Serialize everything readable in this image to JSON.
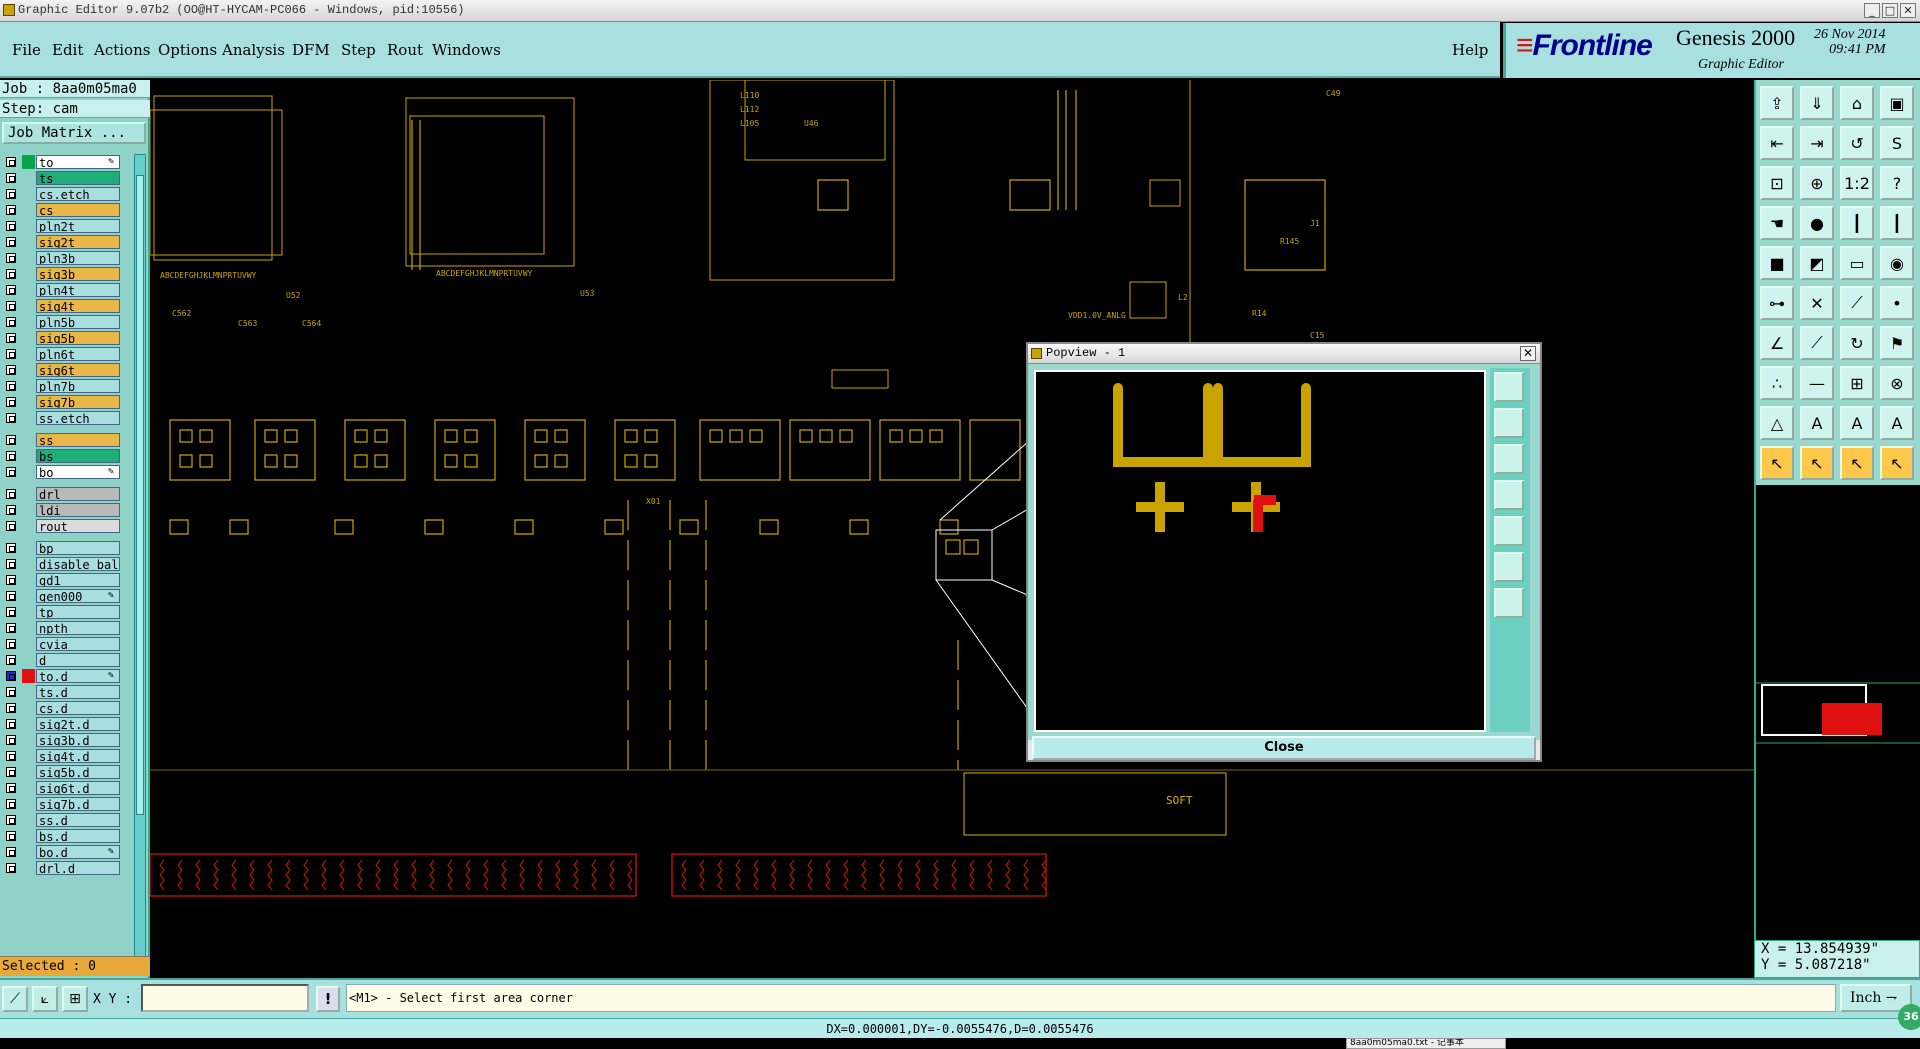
{
  "window": {
    "title": "Graphic Editor 9.07b2 (OO@HT-HYCAM-PC066 - Windows, pid:10556)"
  },
  "menu": [
    {
      "label": "File"
    },
    {
      "label": "Edit"
    },
    {
      "label": "Actions"
    },
    {
      "label": "Options"
    },
    {
      "label": "Analysis"
    },
    {
      "label": "DFM"
    },
    {
      "label": "Step"
    },
    {
      "label": "Rout"
    },
    {
      "label": "Windows"
    }
  ],
  "help_label": "Help",
  "logo": {
    "brand": "Frontline",
    "product": "Genesis 2000",
    "subtitle": "Graphic Editor",
    "date": "26 Nov 2014",
    "time": "09:41 PM"
  },
  "job": {
    "job_line": "Job : 8aa0m05ma0",
    "step_line": "Step: cam",
    "matrix_button": "Job Matrix ..."
  },
  "colors": {
    "gold": "#c9a400",
    "red": "#e01010",
    "cyan": "#a8e0e0",
    "layer_orange": "#e9b648",
    "layer_green": "#1fad7a",
    "layer_cyan": "#a8dede",
    "layer_gray": "#b9b9b9"
  },
  "layers": [
    {
      "name": "to",
      "color": "#ffffff",
      "swatch": "#0aa34a",
      "pen": true
    },
    {
      "name": "ts",
      "color": "#1fad7a",
      "swatch": ""
    },
    {
      "name": "cs.etch",
      "color": "#a8dede",
      "swatch": ""
    },
    {
      "name": "cs",
      "color": "#e9b648",
      "swatch": ""
    },
    {
      "name": "pln2t",
      "color": "#a8dede",
      "swatch": ""
    },
    {
      "name": "sig2t",
      "color": "#e9b648",
      "swatch": ""
    },
    {
      "name": "pln3b",
      "color": "#a8dede",
      "swatch": ""
    },
    {
      "name": "sig3b",
      "color": "#e9b648",
      "swatch": ""
    },
    {
      "name": "pln4t",
      "color": "#a8dede",
      "swatch": ""
    },
    {
      "name": "sig4t",
      "color": "#e9b648",
      "swatch": ""
    },
    {
      "name": "pln5b",
      "color": "#a8dede",
      "swatch": ""
    },
    {
      "name": "sig5b",
      "color": "#e9b648",
      "swatch": ""
    },
    {
      "name": "pln6t",
      "color": "#a8dede",
      "swatch": ""
    },
    {
      "name": "sig6t",
      "color": "#e9b648",
      "swatch": ""
    },
    {
      "name": "pln7b",
      "color": "#a8dede",
      "swatch": ""
    },
    {
      "name": "sig7b",
      "color": "#e9b648",
      "swatch": ""
    },
    {
      "name": "ss.etch",
      "color": "#a8dede",
      "swatch": ""
    },
    {
      "gap": true
    },
    {
      "name": "ss",
      "color": "#e9b648",
      "swatch": ""
    },
    {
      "name": "bs",
      "color": "#1fad7a",
      "swatch": ""
    },
    {
      "name": "bo",
      "color": "#ffffff",
      "swatch": "",
      "pen": true
    },
    {
      "gap": true
    },
    {
      "name": "drl",
      "color": "#b9b9b9",
      "swatch": ""
    },
    {
      "name": "ldi",
      "color": "#b9b9b9",
      "swatch": ""
    },
    {
      "name": "rout",
      "color": "#dcdcdc",
      "swatch": ""
    },
    {
      "gap": true
    },
    {
      "name": "bp",
      "color": "#a8dede",
      "swatch": ""
    },
    {
      "name": "disable_bal",
      "color": "#a8dede",
      "swatch": ""
    },
    {
      "name": "gd1",
      "color": "#a8dede",
      "swatch": ""
    },
    {
      "name": "gen000",
      "color": "#a8dede",
      "swatch": "",
      "pen": true
    },
    {
      "name": "tp",
      "color": "#a8dede",
      "swatch": ""
    },
    {
      "name": "npth",
      "color": "#a8dede",
      "swatch": ""
    },
    {
      "name": "cvia",
      "color": "#a8dede",
      "swatch": ""
    },
    {
      "name": "d",
      "color": "#a8dede",
      "swatch": ""
    },
    {
      "name": "to.d",
      "color": "#a8dede",
      "swatch": "#e01010",
      "checked": true,
      "pen": true
    },
    {
      "name": "ts.d",
      "color": "#a8dede",
      "swatch": ""
    },
    {
      "name": "cs.d",
      "color": "#a8dede",
      "swatch": ""
    },
    {
      "name": "sig2t.d",
      "color": "#a8dede",
      "swatch": ""
    },
    {
      "name": "sig3b.d",
      "color": "#a8dede",
      "swatch": ""
    },
    {
      "name": "sig4t.d",
      "color": "#a8dede",
      "swatch": ""
    },
    {
      "name": "sig5b.d",
      "color": "#a8dede",
      "swatch": ""
    },
    {
      "name": "sig6t.d",
      "color": "#a8dede",
      "swatch": ""
    },
    {
      "name": "sig7b.d",
      "color": "#a8dede",
      "swatch": ""
    },
    {
      "name": "ss.d",
      "color": "#a8dede",
      "swatch": ""
    },
    {
      "name": "bs.d",
      "color": "#a8dede",
      "swatch": ""
    },
    {
      "name": "bo.d",
      "color": "#a8dede",
      "swatch": "",
      "pen": true
    },
    {
      "name": "drl.d",
      "color": "#a8dede",
      "swatch": ""
    }
  ],
  "selected_label": "Selected : 0",
  "canvas": {
    "labels": [
      "ABCDEFGHJKLMNPRTUVWY",
      "U52",
      "ABCDEFGHJKLMNPRTUVWY",
      "U53",
      "C562",
      "C563",
      "C564",
      "VDD1.0V_ANLG",
      "SOFT",
      "X01",
      "L110",
      "L112",
      "L105",
      "U46",
      "R145",
      "J1",
      "R14",
      "L2",
      "C15",
      "C49"
    ]
  },
  "popview": {
    "title": "Popview - 1",
    "close_label": "Close"
  },
  "coords": {
    "x": "X = 13.854939\"",
    "y": "Y = 5.087218\""
  },
  "bottom": {
    "xy_label": "X Y :",
    "xy_value": "",
    "prompt": "<M1> - Select first area corner",
    "unit": "Inch",
    "status": "DX=0.000001,DY=-0.0055476,D=0.0055476",
    "task_hint": "8aa0m05ma0.txt - 记事本",
    "badge": "36"
  }
}
